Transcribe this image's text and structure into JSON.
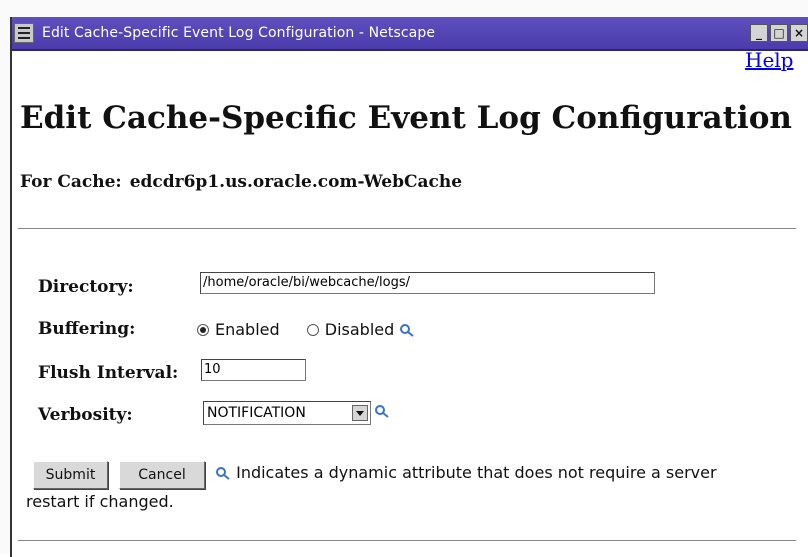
{
  "window": {
    "title": "Edit Cache-Specific Event Log Configuration - Netscape",
    "minimize_label": "_",
    "maximize_label": "□",
    "close_label": "×"
  },
  "page": {
    "help_link": "Help",
    "heading": "Edit Cache-Specific Event Log Configuration",
    "cache_label": "For Cache:",
    "cache_name": "edcdr6p1.us.oracle.com-WebCache"
  },
  "form": {
    "directory": {
      "label": "Directory:",
      "value": "/home/oracle/bi/webcache/logs/"
    },
    "buffering": {
      "label": "Buffering:",
      "options": [
        {
          "label": "Enabled",
          "selected": true
        },
        {
          "label": "Disabled",
          "selected": false
        }
      ]
    },
    "flush_interval": {
      "label": "Flush Interval:",
      "value": "10"
    },
    "verbosity": {
      "label": "Verbosity:",
      "selected": "NOTIFICATION"
    }
  },
  "actions": {
    "submit_label": "Submit",
    "cancel_label": "Cancel",
    "note_line1": "Indicates a dynamic attribute that does not require a server",
    "note_line2": "restart if changed."
  },
  "colors": {
    "titlebar": "#4a3cac",
    "link": "#0000ee",
    "dynamic_icon": "#3a6fd8"
  }
}
